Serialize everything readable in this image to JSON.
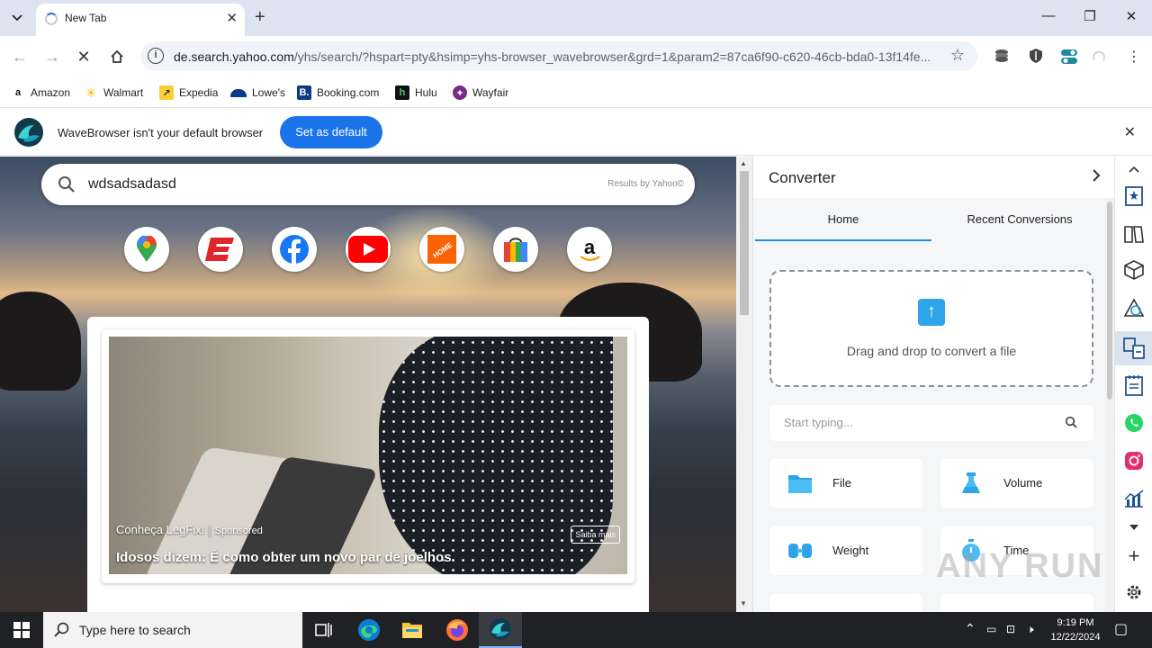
{
  "browser": {
    "tab_title": "New Tab",
    "url_host": "de.search.yahoo.com",
    "url_path": "/yhs/search/?hspart=pty&hsimp=yhs-browser_wavebrowser&grd=1&param2=87ca6f90-c620-46cb-bda0-13f14fe..."
  },
  "bookmarks": [
    {
      "label": "Amazon",
      "icon": "amazon-icon"
    },
    {
      "label": "Walmart",
      "icon": "walmart-icon"
    },
    {
      "label": "Expedia",
      "icon": "expedia-icon"
    },
    {
      "label": "Lowe's",
      "icon": "lowes-icon"
    },
    {
      "label": "Booking.com",
      "icon": "booking-icon"
    },
    {
      "label": "Hulu",
      "icon": "hulu-icon"
    },
    {
      "label": "Wayfair",
      "icon": "wayfair-icon"
    }
  ],
  "infobar": {
    "message": "WaveBrowser isn't your default browser",
    "button": "Set as default"
  },
  "search": {
    "value": "wdsadsadasd",
    "results_by": "Results by Yahoo©"
  },
  "quick_links": [
    "maps-icon",
    "espn-icon",
    "facebook-icon",
    "youtube-icon",
    "homedepot-icon",
    "shopping-icon",
    "amazon-icon"
  ],
  "ad": {
    "source": "Conheça LegFix!",
    "sponsored": "Sponsored",
    "headline": "Idosos dizem: É como obter um novo par de joelhos",
    "cta": "Saiba mais"
  },
  "converter": {
    "title": "Converter",
    "tabs": [
      "Home",
      "Recent Conversions"
    ],
    "active_tab": "Home",
    "drop_text": "Drag and drop to convert a file",
    "search_placeholder": "Start typing...",
    "units": [
      {
        "label": "File",
        "icon": "folder-icon"
      },
      {
        "label": "Volume",
        "icon": "flask-icon"
      },
      {
        "label": "Weight",
        "icon": "dumbbell-icon"
      },
      {
        "label": "Time",
        "icon": "stopwatch-icon"
      }
    ]
  },
  "watermark": "ANY RUN",
  "taskbar": {
    "search_placeholder": "Type here to search",
    "time": "9:19 PM",
    "date": "12/22/2024"
  },
  "colors": {
    "accent": "#1a73e8",
    "converter_accent": "#1a8ee0",
    "taskbar": "#202124"
  }
}
